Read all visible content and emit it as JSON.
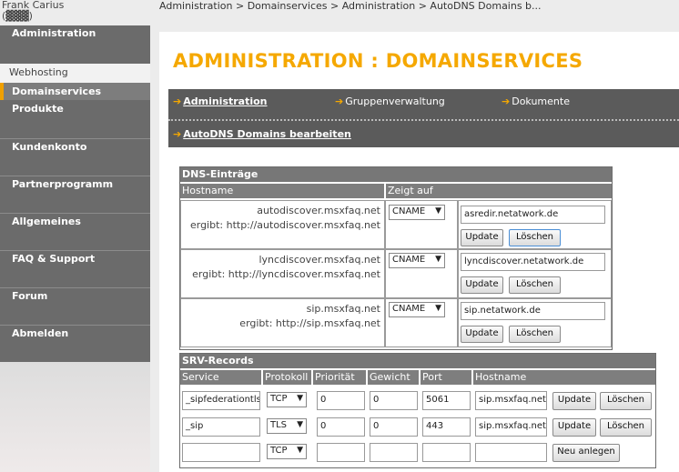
{
  "user": {
    "name": "Frank Carius",
    "redacted": "(▓▓▓)"
  },
  "breadcrumb": "Administration > Domainservices > Administration > AutoDNS Domains b...",
  "sidebar": {
    "top_item": "Administration",
    "sub_items": [
      "Webhosting",
      "Domainservices"
    ],
    "items": [
      "Produkte",
      "Kundenkonto",
      "Partnerprogramm",
      "Allgemeines",
      "FAQ & Support",
      "Forum",
      "Abmelden"
    ]
  },
  "page_title": "ADMINISTRATION : DOMAINSERVICES",
  "subnav": {
    "administration": "Administration",
    "gruppen": "Gruppenverwaltung",
    "dokumente": "Dokumente",
    "autodns": "AutoDNS Domains bearbeiten"
  },
  "dns": {
    "title": "DNS-Einträge",
    "col_hostname": "Hostname",
    "col_zeigt": "Zeigt auf",
    "update_label": "Update",
    "delete_label": "Löschen",
    "rows": [
      {
        "host": "autodiscover.msxfaq.net",
        "result": "ergibt: http://autodiscover.msxfaq.net",
        "type": "CNAME",
        "target": "asredir.netatwork.de"
      },
      {
        "host": "lyncdiscover.msxfaq.net",
        "result": "ergibt: http://lyncdiscover.msxfaq.net",
        "type": "CNAME",
        "target": "lyncdiscover.netatwork.de"
      },
      {
        "host": "sip.msxfaq.net",
        "result": "ergibt: http://sip.msxfaq.net",
        "type": "CNAME",
        "target": "sip.netatwork.de"
      }
    ]
  },
  "srv": {
    "title": "SRV-Records",
    "cols": [
      "Service",
      "Protokoll",
      "Priorität",
      "Gewicht",
      "Port",
      "Hostname"
    ],
    "rows": [
      {
        "service": "_sipfederationtls",
        "protocol": "TCP",
        "priority": "0",
        "weight": "0",
        "port": "5061",
        "host": "sip.msxfaq.net"
      },
      {
        "service": "_sip",
        "protocol": "TLS",
        "priority": "0",
        "weight": "0",
        "port": "443",
        "host": "sip.msxfaq.net"
      }
    ],
    "new_protocol": "TCP",
    "new_label": "Neu anlegen"
  }
}
